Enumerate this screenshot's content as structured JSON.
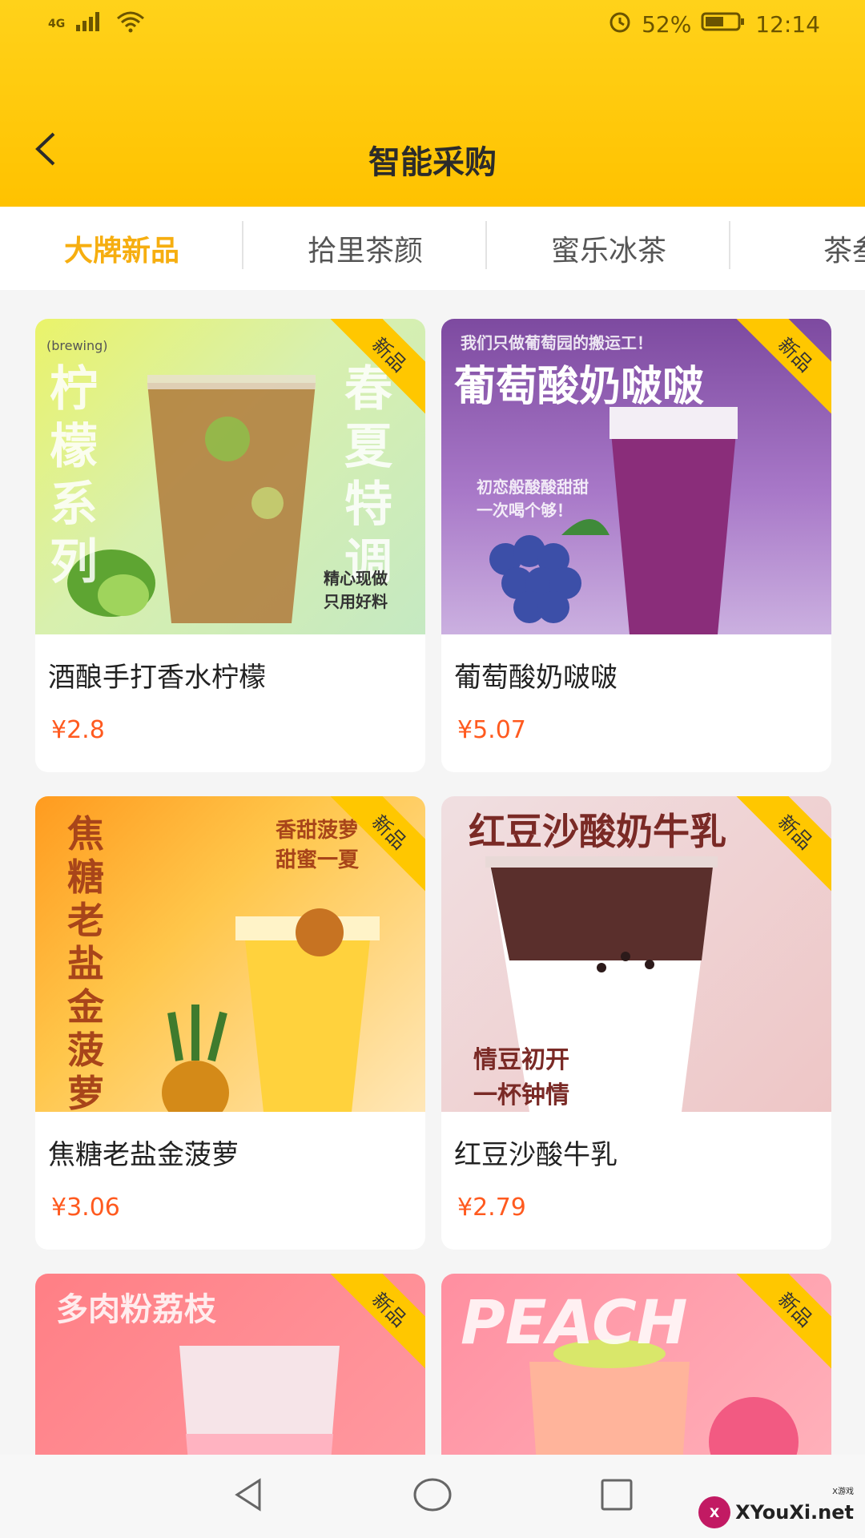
{
  "status_bar": {
    "network": "4G",
    "battery_percent": "52%",
    "time": "12:14"
  },
  "header": {
    "title": "智能采购"
  },
  "tabs": [
    {
      "label": "大牌新品",
      "active": true
    },
    {
      "label": "拾里茶颜",
      "active": false
    },
    {
      "label": "蜜乐冰茶",
      "active": false
    },
    {
      "label": "茶叁",
      "active": false
    }
  ],
  "badge_label": "新品",
  "products": [
    {
      "name": "酒酿手打香水柠檬",
      "price": "¥2.8"
    },
    {
      "name": "葡萄酸奶啵啵",
      "price": "¥5.07"
    },
    {
      "name": "焦糖老盐金菠萝",
      "price": "¥3.06"
    },
    {
      "name": "红豆沙酸牛乳",
      "price": "¥2.79"
    },
    {
      "name": "",
      "price": ""
    },
    {
      "name": "",
      "price": ""
    }
  ],
  "image_texts": {
    "p1_left": "柠檬系列",
    "p1_right": "春夏特调",
    "p1_tag": "(brewing)",
    "p1_small": "精心现做 只用好料",
    "p2_head": "葡萄酸奶啵啵",
    "p2_top": "我们只做葡萄园的搬运工！",
    "p2_mid": "初恋般酸酸甜甜 一次喝个够！",
    "p3_left": "焦糖老盐金菠萝",
    "p3_right": "香甜菠萝 甜蜜一夏",
    "p4_head": "红豆沙酸奶牛乳",
    "p4_mid": "情豆初开 一杯钟情",
    "p5_head": "多肉粉荔枝",
    "p6_head": "PEACH"
  },
  "watermark": {
    "text": "XYouXi.net",
    "mini": "X游戏"
  }
}
